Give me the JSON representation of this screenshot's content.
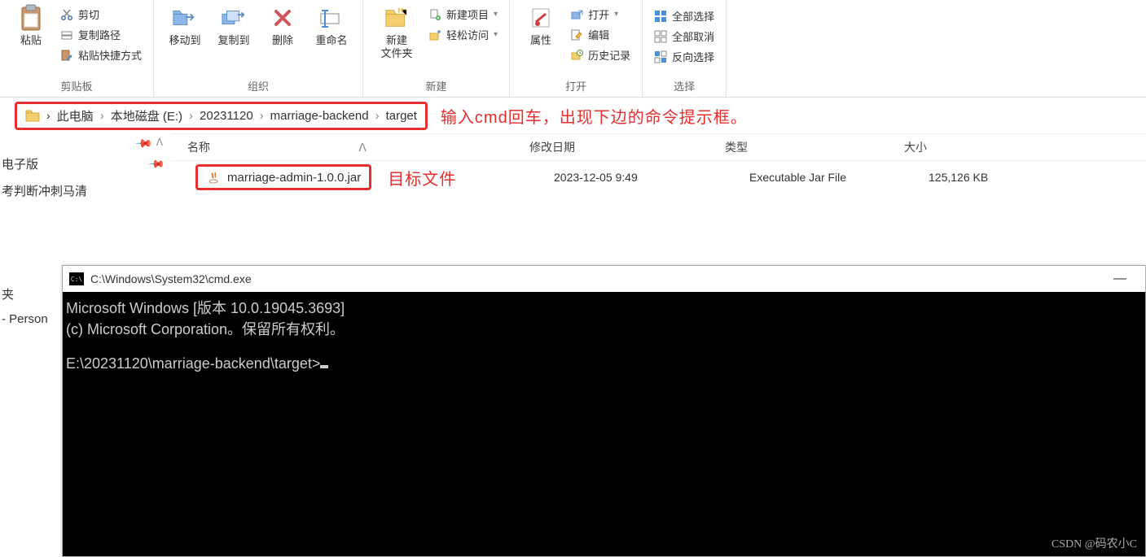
{
  "ribbon": {
    "clipboard": {
      "label": "剪贴板",
      "paste": "粘贴",
      "cut": "剪切",
      "copypath": "复制路径",
      "paste_shortcut": "粘贴快捷方式"
    },
    "organize": {
      "label": "组织",
      "moveto": "移动到",
      "copyto": "复制到",
      "delete": "删除",
      "rename": "重命名"
    },
    "new": {
      "label": "新建",
      "newfolder": "新建\n文件夹",
      "newitem": "新建项目",
      "easyaccess": "轻松访问"
    },
    "open": {
      "label": "打开",
      "properties": "属性",
      "open": "打开",
      "edit": "编辑",
      "history": "历史记录"
    },
    "select": {
      "label": "选择",
      "all": "全部选择",
      "none": "全部取消",
      "invert": "反向选择"
    }
  },
  "breadcrumb": {
    "items": [
      "此电脑",
      "本地磁盘 (E:)",
      "20231120",
      "marriage-backend",
      "target"
    ]
  },
  "annotation": {
    "addr": "输入cmd回车，出现下边的命令提示框。",
    "target": "目标文件"
  },
  "columns": {
    "name": "名称",
    "date": "修改日期",
    "type": "类型",
    "size": "大小"
  },
  "nav": {
    "items": [
      "电子版",
      "考判断冲刺马清"
    ],
    "personal": "- Person"
  },
  "file": {
    "name": "marriage-admin-1.0.0.jar",
    "date": "2023-12-05 9:49",
    "type": "Executable Jar File",
    "size": "125,126 KB"
  },
  "cmd": {
    "title": "C:\\Windows\\System32\\cmd.exe",
    "line1": "Microsoft Windows [版本 10.0.19045.3693]",
    "line2": "(c) Microsoft Corporation。保留所有权利。",
    "prompt": "E:\\20231120\\marriage-backend\\target>",
    "min": "—"
  },
  "watermark": "CSDN @码农小C"
}
